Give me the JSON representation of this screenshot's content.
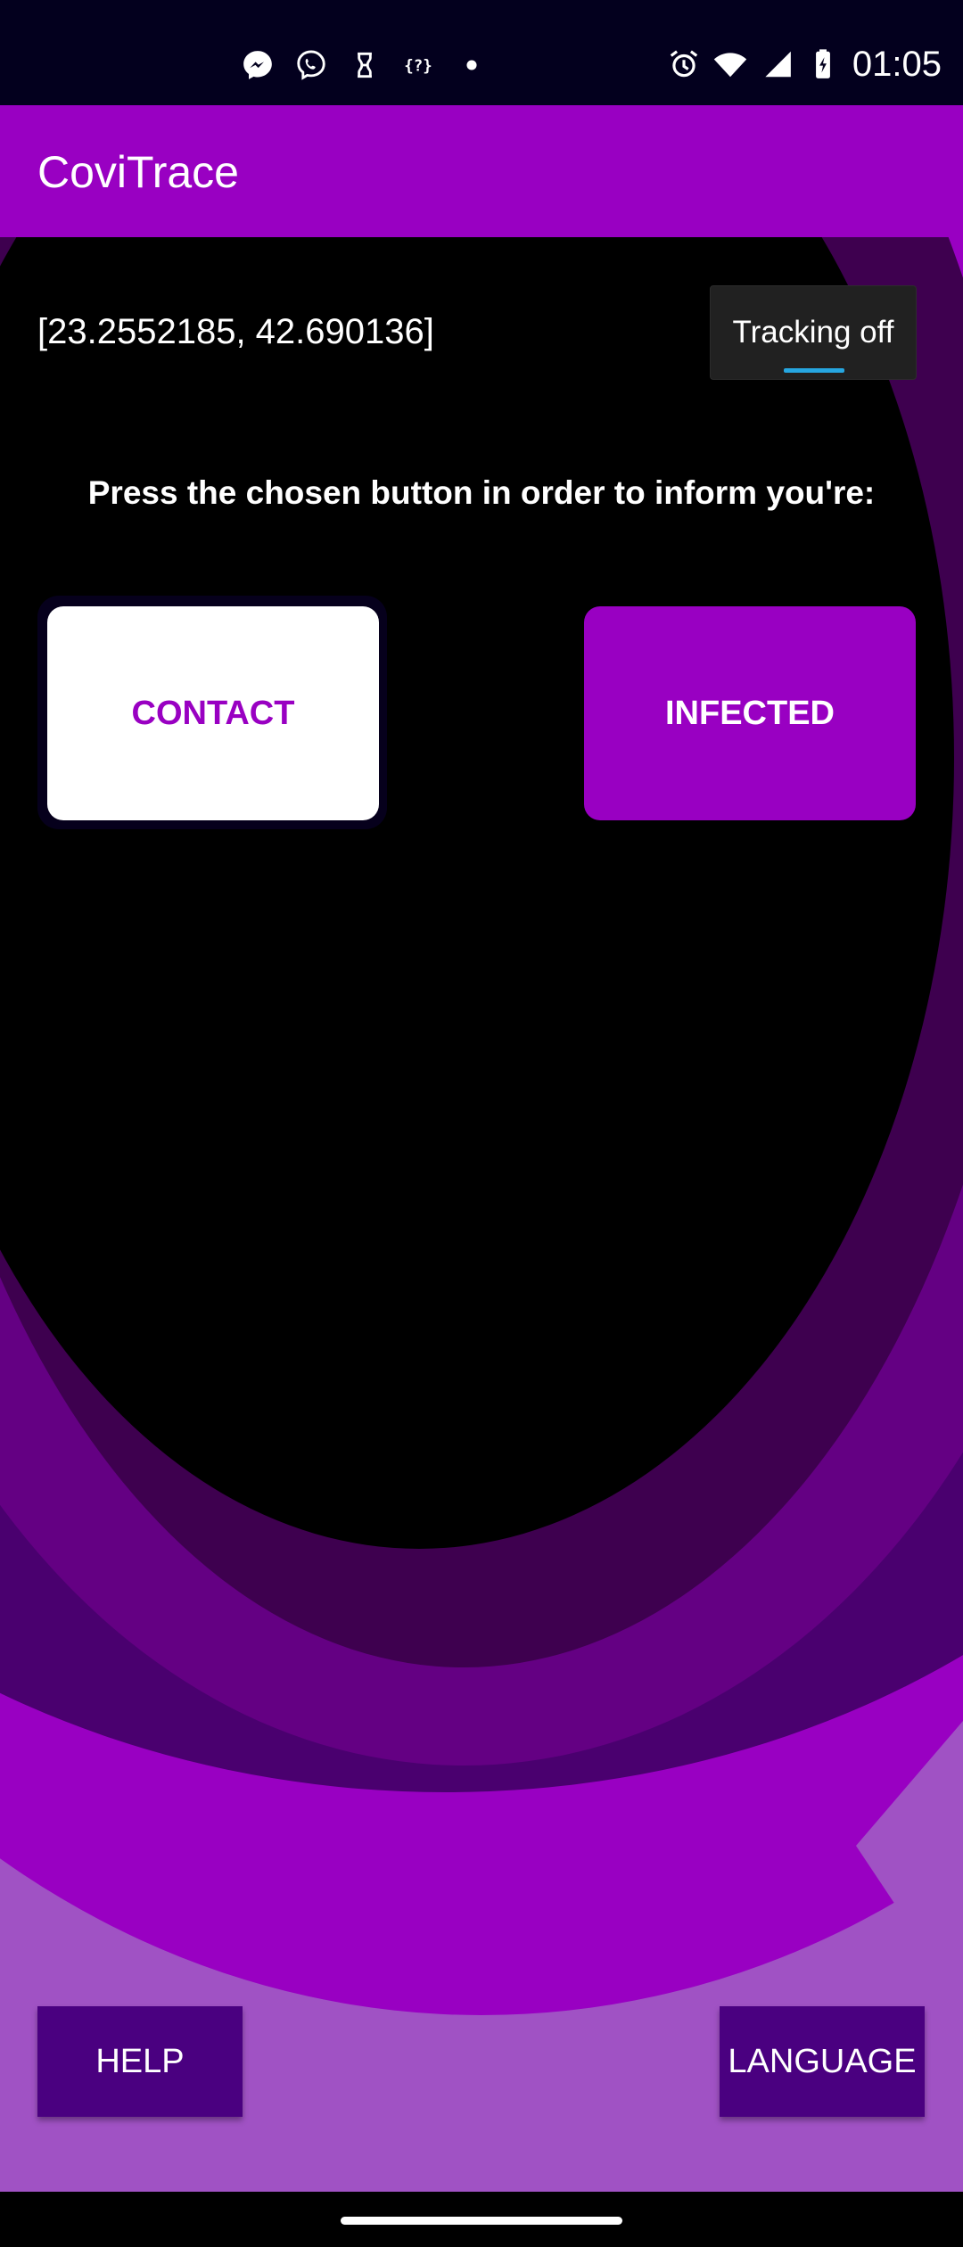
{
  "status_bar": {
    "time": "01:05",
    "left_icons": [
      "messenger-icon",
      "viber-icon",
      "app-notification-icon",
      "code-icon",
      "dot-icon"
    ],
    "right_icons": [
      "alarm-icon",
      "wifi-icon",
      "signal-icon",
      "battery-charging-icon"
    ]
  },
  "app_bar": {
    "title": "CoviTrace"
  },
  "location": {
    "coordinates": "[23.2552185, 42.690136]"
  },
  "tracking": {
    "label": "Tracking off",
    "enabled": false
  },
  "prompt": "Press the chosen button in order to inform you're:",
  "buttons": {
    "contact": "CONTACT",
    "infected": "INFECTED",
    "help": "HELP",
    "language": "LANGUAGE"
  },
  "colors": {
    "brand": "#9900c2",
    "dark_button": "#4a0080",
    "status_bar": "#03001e",
    "toggle_indicator": "#26a6e0"
  }
}
